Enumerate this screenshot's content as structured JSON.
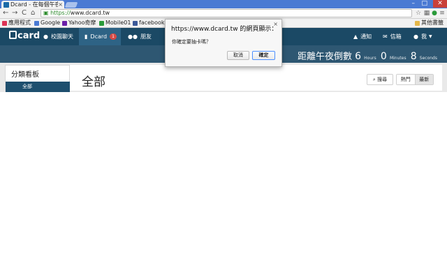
{
  "browser": {
    "tab_title": "Dcard - 在每個午夜",
    "tab_close": "×",
    "url_https": "https://",
    "url_host": "www.dcard.tw",
    "win_min": "–",
    "win_max": "□",
    "win_close": "✕",
    "back": "←",
    "forward": "→",
    "reload": "C",
    "home": "⌂",
    "lock": "🔒"
  },
  "bookmarks": {
    "apps": "應用程式",
    "google": "Google",
    "yahoo": "Yahoo奇摩",
    "mobile01": "Mobile01",
    "facebook": "facebook",
    "other": "其他書籤"
  },
  "navbar": {
    "logo": "card",
    "campus_chat": "校園聊天",
    "dcard": "Dcard",
    "dcard_badge": "1",
    "friends": "朋友",
    "notifications": "通知",
    "inbox": "信箱",
    "me": "我"
  },
  "countdown": {
    "label": "距離午夜倒數",
    "hours": "6",
    "hours_unit": "Hours",
    "minutes": "0",
    "minutes_unit": "Minutes",
    "seconds": "8",
    "seconds_unit": "Seconds"
  },
  "sidebar": {
    "title": "分類看板",
    "items": [
      {
        "label": "全部"
      }
    ]
  },
  "main": {
    "title": "全部",
    "search": "搜尋",
    "sort_hot": "熱門",
    "sort_new": "最新"
  },
  "dialog": {
    "title": "https://www.dcard.tw 的網頁顯示：",
    "message": "你確定要抽卡嗎？",
    "cancel": "取消",
    "ok": "確定",
    "close": "×"
  },
  "colors": {
    "navbar": "#1b4965",
    "countbar": "#2e5772",
    "sidebar_active": "#1e4f6e",
    "badge": "#d64a45"
  }
}
